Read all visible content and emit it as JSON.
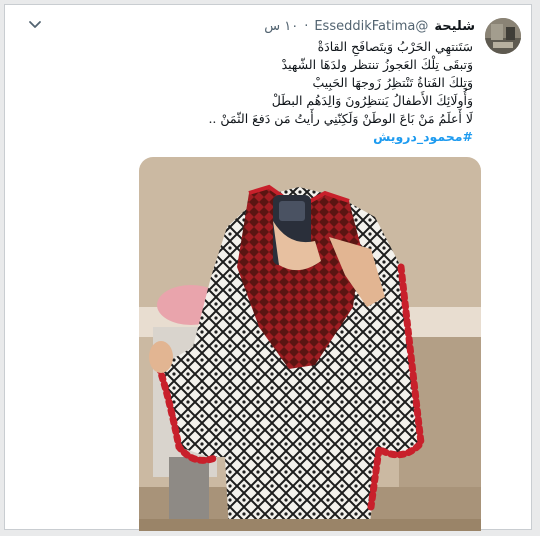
{
  "tweet": {
    "display_name": "شليحة",
    "handle": "@EsseddikFatima",
    "separator": "·",
    "time": "١٠ س",
    "lines": [
      "سَتَنتهِي الحَرْبُ وَيتَصافَحِ القادَةْ",
      "وَتبقَى تِلْكَ العَجوزُ تنتظر ولدَهَا الشّهيدْ",
      "وَتِلكَ الفَتاةُ تَنْتظِرُ زَوجهَا الحَبِيبْ",
      "وَأُولَائِكَ الأَطفالُ يَنتظِرُونَ وَالِدَهُم البطَلْ",
      "لَا أَعلَمُ مَنْ بَاعَ الوطَنْ وَلَكِنّنِي رأَيتُ مَن دَفعَ الثّمَنْ .."
    ],
    "hashtag": "#محمود_درويش"
  },
  "icons": {
    "avatar": "avatar-photo",
    "more": "chevron-down-icon",
    "media": "photo"
  },
  "colors": {
    "link": "#1d9bf0",
    "text": "#0f1419",
    "muted": "#536471",
    "keffiyeh_red": "#c8202b"
  }
}
